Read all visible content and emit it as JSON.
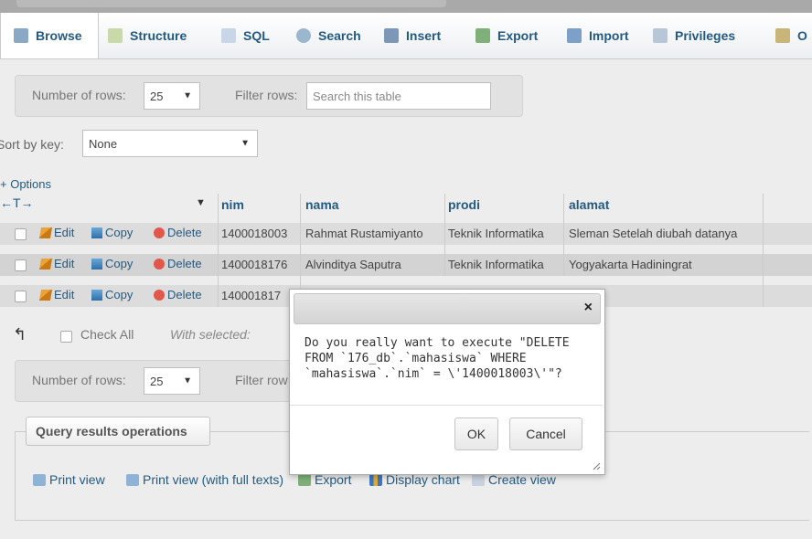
{
  "tabs": [
    {
      "label": "Browse",
      "icon": "browse-icon"
    },
    {
      "label": "Structure",
      "icon": "structure-icon"
    },
    {
      "label": "SQL",
      "icon": "sql-icon"
    },
    {
      "label": "Search",
      "icon": "search-icon"
    },
    {
      "label": "Insert",
      "icon": "insert-icon"
    },
    {
      "label": "Export",
      "icon": "export-icon"
    },
    {
      "label": "Import",
      "icon": "import-icon"
    },
    {
      "label": "Privileges",
      "icon": "privileges-icon"
    },
    {
      "label": "O",
      "icon": "operations-icon"
    }
  ],
  "top_nav": {
    "number_of_rows_label": "Number of rows:",
    "rows_value": "25",
    "filter_label": "Filter rows:",
    "filter_placeholder": "Search this table"
  },
  "sort": {
    "label": "Sort by key:",
    "value": "None"
  },
  "options_label": "+ Options",
  "arrows_label": "←T→",
  "columns": [
    "nim",
    "nama",
    "prodi",
    "alamat"
  ],
  "row_actions": {
    "edit": "Edit",
    "copy": "Copy",
    "delete": "Delete"
  },
  "rows": [
    {
      "nim": "1400018003",
      "nama": "Rahmat Rustamiyanto",
      "prodi": "Teknik Informatika",
      "alamat": "Sleman Setelah diubah datanya"
    },
    {
      "nim": "1400018176",
      "nama": "Alvinditya Saputra",
      "prodi": "Teknik Informatika",
      "alamat": "Yogyakarta Hadiningrat"
    },
    {
      "nim": "140001817",
      "nama": "",
      "prodi": "",
      "alamat": ""
    }
  ],
  "bulk": {
    "check_all": "Check All",
    "with_selected": "With selected:"
  },
  "bottom_nav": {
    "number_of_rows_label": "Number of rows:",
    "rows_value": "25",
    "filter_label": "Filter row"
  },
  "query_ops": {
    "title": "Query results operations",
    "links": [
      "Print view",
      "Print view (with full texts)",
      "Export",
      "Display chart",
      "Create view"
    ]
  },
  "dialog": {
    "close": "×",
    "message_lines": [
      "Do you really want to execute \"DELETE",
      "FROM `176_db`.`mahasiswa` WHERE",
      "`mahasiswa`.`nim` = \\'1400018003\\'\"?"
    ],
    "ok": "OK",
    "cancel": "Cancel"
  },
  "colors": {
    "link": "#235a81",
    "row_highlight": "#d8d8d8",
    "background": "#ededed"
  }
}
